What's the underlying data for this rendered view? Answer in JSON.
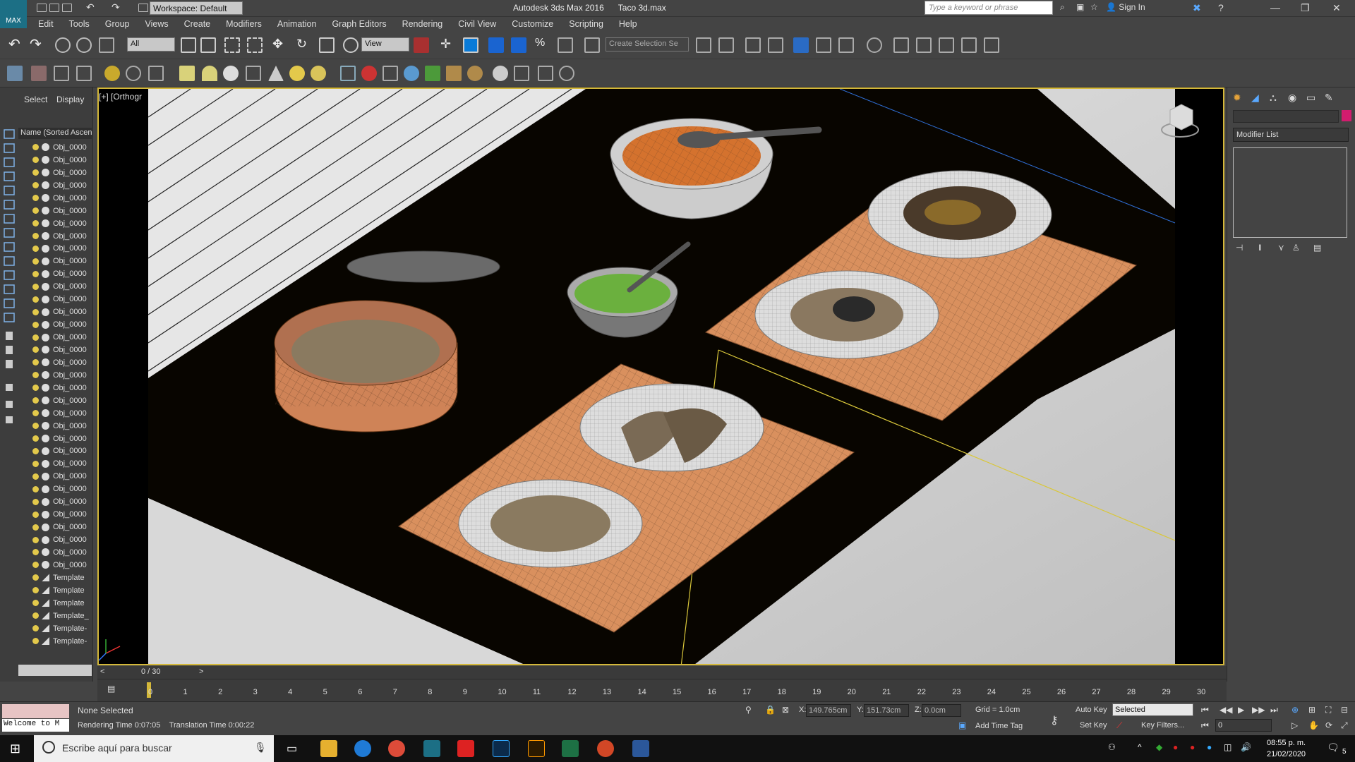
{
  "titlebar": {
    "app_logo_label": "MAX",
    "workspace": "Workspace: Default",
    "app_title": "Autodesk 3ds Max 2016",
    "file_name": "Taco 3d.max",
    "search_placeholder": "Type a keyword or phrase",
    "sign_in": "Sign In"
  },
  "menu": [
    "Edit",
    "Tools",
    "Group",
    "Views",
    "Create",
    "Modifiers",
    "Animation",
    "Graph Editors",
    "Rendering",
    "Civil View",
    "Customize",
    "Scripting",
    "Help"
  ],
  "toolbar": {
    "selection_filter": "All",
    "ref_coord": "View",
    "named_selection": "Create Selection Se"
  },
  "scene_explorer": {
    "tab_select": "Select",
    "tab_display": "Display",
    "header": "Name (Sorted Ascen",
    "items": [
      {
        "label": "Obj_0000",
        "kind": "object"
      },
      {
        "label": "Obj_0000",
        "kind": "object"
      },
      {
        "label": "Obj_0000",
        "kind": "object"
      },
      {
        "label": "Obj_0000",
        "kind": "object"
      },
      {
        "label": "Obj_0000",
        "kind": "object"
      },
      {
        "label": "Obj_0000",
        "kind": "object"
      },
      {
        "label": "Obj_0000",
        "kind": "object"
      },
      {
        "label": "Obj_0000",
        "kind": "object"
      },
      {
        "label": "Obj_0000",
        "kind": "object"
      },
      {
        "label": "Obj_0000",
        "kind": "object"
      },
      {
        "label": "Obj_0000",
        "kind": "object"
      },
      {
        "label": "Obj_0000",
        "kind": "object"
      },
      {
        "label": "Obj_0000",
        "kind": "object"
      },
      {
        "label": "Obj_0000",
        "kind": "object"
      },
      {
        "label": "Obj_0000",
        "kind": "object"
      },
      {
        "label": "Obj_0000",
        "kind": "object"
      },
      {
        "label": "Obj_0000",
        "kind": "object"
      },
      {
        "label": "Obj_0000",
        "kind": "object"
      },
      {
        "label": "Obj_0000",
        "kind": "object"
      },
      {
        "label": "Obj_0000",
        "kind": "object"
      },
      {
        "label": "Obj_0000",
        "kind": "object"
      },
      {
        "label": "Obj_0000",
        "kind": "object"
      },
      {
        "label": "Obj_0000",
        "kind": "object"
      },
      {
        "label": "Obj_0000",
        "kind": "object"
      },
      {
        "label": "Obj_0000",
        "kind": "object"
      },
      {
        "label": "Obj_0000",
        "kind": "object"
      },
      {
        "label": "Obj_0000",
        "kind": "object"
      },
      {
        "label": "Obj_0000",
        "kind": "object"
      },
      {
        "label": "Obj_0000",
        "kind": "object"
      },
      {
        "label": "Obj_0000",
        "kind": "object"
      },
      {
        "label": "Obj_0000",
        "kind": "object"
      },
      {
        "label": "Obj_0000",
        "kind": "object"
      },
      {
        "label": "Obj_0000",
        "kind": "object"
      },
      {
        "label": "Obj_0000",
        "kind": "object"
      },
      {
        "label": "Template",
        "kind": "template"
      },
      {
        "label": "Template",
        "kind": "template"
      },
      {
        "label": "Template",
        "kind": "template"
      },
      {
        "label": "Template_",
        "kind": "template"
      },
      {
        "label": "Template-",
        "kind": "template"
      },
      {
        "label": "Template-",
        "kind": "template"
      }
    ]
  },
  "viewport": {
    "label": "[+] [Orthogr",
    "frame_counter": "0 / 30"
  },
  "command_panel": {
    "modifier_list": "Modifier List"
  },
  "timeline": {
    "ticks": [
      "0",
      "1",
      "2",
      "3",
      "4",
      "5",
      "6",
      "7",
      "8",
      "9",
      "10",
      "11",
      "12",
      "13",
      "14",
      "15",
      "16",
      "17",
      "18",
      "19",
      "20",
      "21",
      "22",
      "23",
      "24",
      "25",
      "26",
      "27",
      "28",
      "29",
      "30"
    ]
  },
  "status": {
    "maxscript_welcome": "Welcome to M",
    "selection": "None Selected",
    "prompt_render": "Rendering Time  0:07:05",
    "prompt_translation": "Translation Time  0:00:22",
    "x_label": "X:",
    "x_value": "149.765cm",
    "y_label": "Y:",
    "y_value": "151.73cm",
    "z_label": "Z:",
    "z_value": "0.0cm",
    "grid": "Grid = 1.0cm",
    "add_time_tag": "Add Time Tag",
    "auto_key": "Auto Key",
    "set_key": "Set Key",
    "key_mode": "Selected",
    "key_filters": "Key Filters...",
    "current_frame": "0"
  },
  "taskbar": {
    "search": "Escribe aquí para buscar",
    "time": "08:55 p. m.",
    "date": "21/02/2020",
    "notification_count": "5"
  }
}
